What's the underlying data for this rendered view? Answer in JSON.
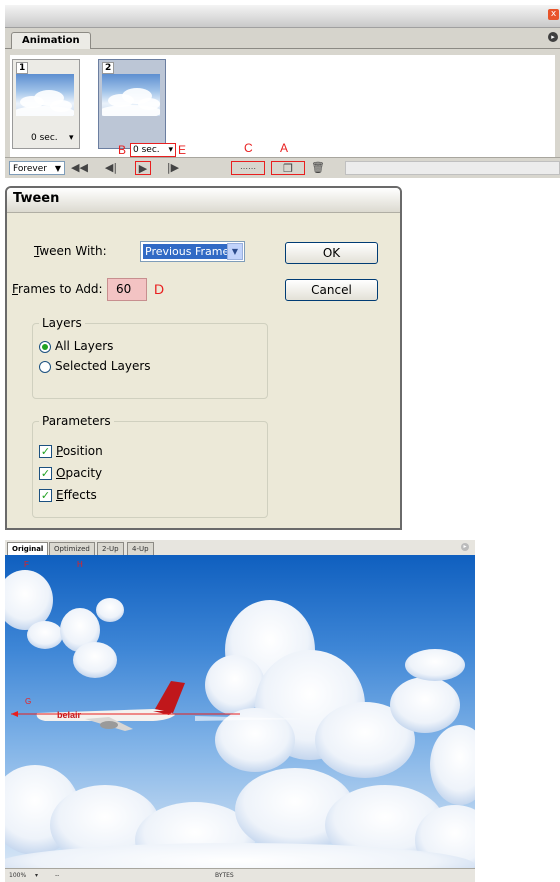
{
  "animation_panel": {
    "tab_label": "Animation",
    "close_glyph": "x",
    "menu_glyph": "▸",
    "frames": [
      {
        "number": "1",
        "delay": "0 sec.",
        "selected": false
      },
      {
        "number": "2",
        "delay": "0 sec.",
        "selected": true
      }
    ],
    "loop_option": "Forever",
    "toolbar_icons": [
      "rewind-icon",
      "previous-frame-icon",
      "play-icon",
      "next-frame-icon",
      "tween-icon",
      "duplicate-frame-icon",
      "delete-frame-icon"
    ],
    "annotations": {
      "a": "A",
      "b": "B",
      "c": "C",
      "e": "E"
    }
  },
  "tween_dialog": {
    "title": "Tween",
    "tween_with_label_prefix": "",
    "tween_with_label_underlined": "T",
    "tween_with_label_rest": "ween With:",
    "tween_with_value": "Previous Frame",
    "frames_label_underlined": "F",
    "frames_label_rest": "rames to Add:",
    "frames_value": "60",
    "annotation_d": "D",
    "ok_label": "OK",
    "cancel_label": "Cancel",
    "layers": {
      "legend": "Layers",
      "all_layers": "All Layers",
      "selected_layers": "Selected Layers",
      "selected": "all"
    },
    "parameters": {
      "legend": "Parameters",
      "position_underlined": "P",
      "position_rest": "osition",
      "opacity_underlined": "O",
      "opacity_rest": "pacity",
      "effects_underlined": "E",
      "effects_rest": "ffects",
      "position_checked": true,
      "opacity_checked": true,
      "effects_checked": true,
      "check_glyph": "✓"
    }
  },
  "document_window": {
    "tabs": [
      "Original",
      "Optimized",
      "2-Up",
      "4-Up"
    ],
    "active_tab": "Original",
    "annotations": {
      "f": "F",
      "g": "G",
      "h": "H"
    },
    "aircraft_livery": "belair",
    "status_items": [
      "100%",
      "--",
      "BYTES"
    ],
    "accent_red": "#e81f1f"
  }
}
